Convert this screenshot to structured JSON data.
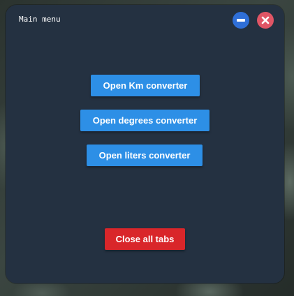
{
  "window": {
    "title": "Main menu"
  },
  "controls": {
    "minimize_icon": "minus-circle-icon",
    "close_icon": "x-circle-icon"
  },
  "buttons": {
    "km_converter": "Open Km converter",
    "degrees_converter": "Open degrees converter",
    "liters_converter": "Open liters converter",
    "close_all": "Close all tabs"
  },
  "colors": {
    "window_bg": "#243141",
    "primary_button": "#2d8fe6",
    "danger_button": "#d9262a",
    "minimize": "#2f6fd8",
    "close": "#e05565"
  }
}
